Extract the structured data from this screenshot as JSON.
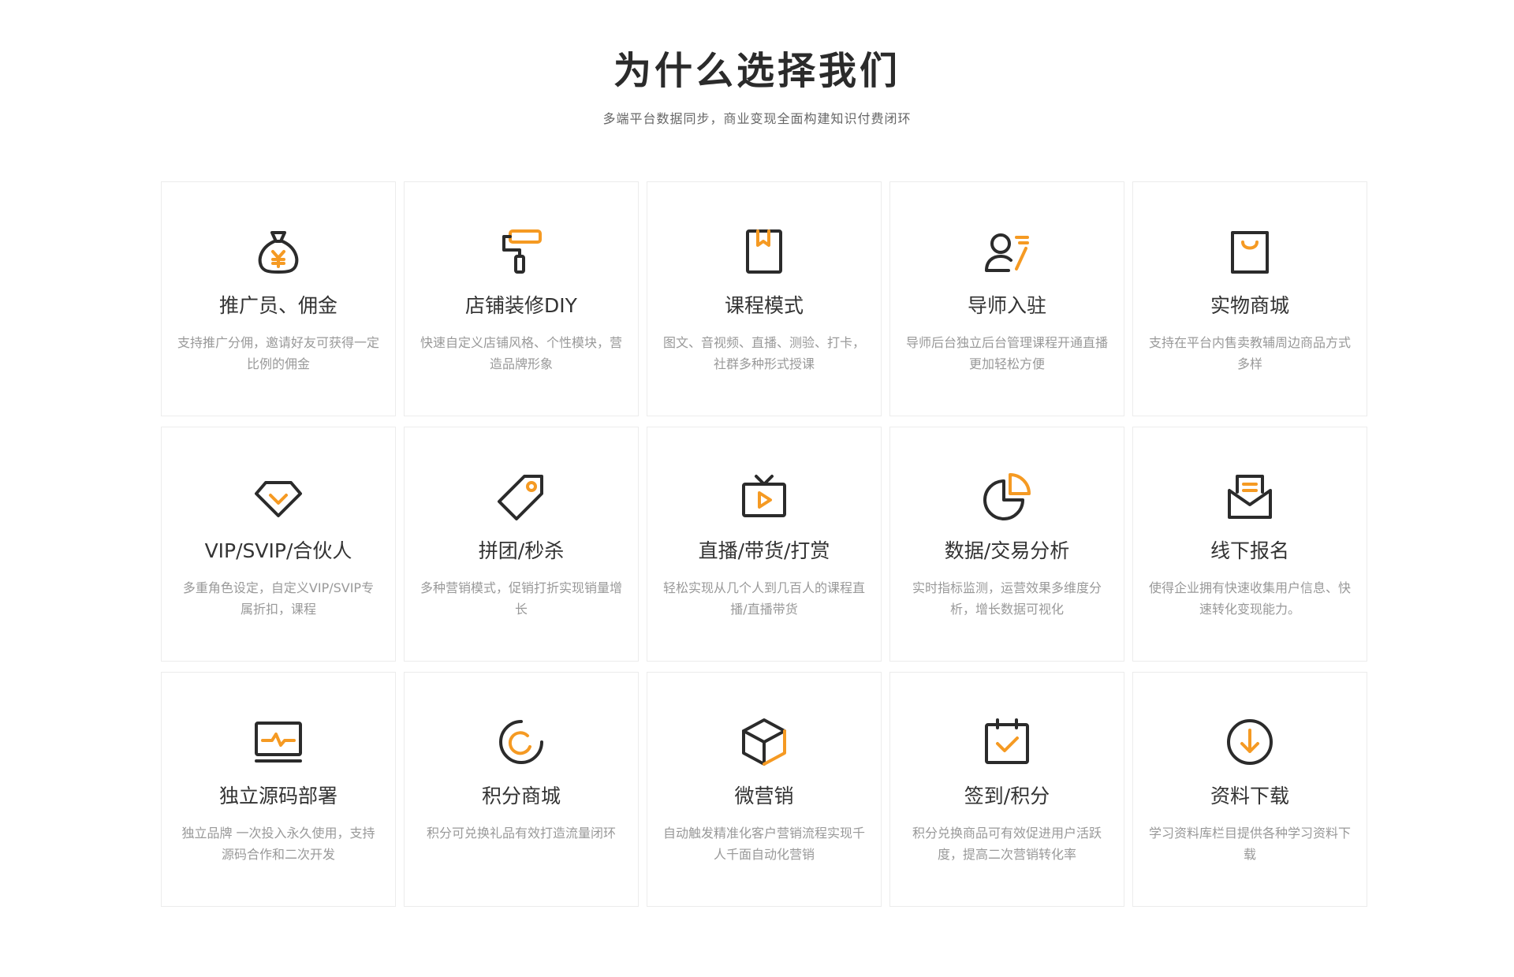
{
  "header": {
    "title": "为什么选择我们",
    "subtitle": "多端平台数据同步，商业变现全面构建知识付费闭环"
  },
  "colors": {
    "accent": "#f59a23",
    "stroke": "#2b2b2b"
  },
  "features": [
    {
      "icon": "money-bag-icon",
      "title": "推广员、佣金",
      "desc": "支持推广分佣，邀请好友可获得一定比例的佣金"
    },
    {
      "icon": "paint-roller-icon",
      "title": "店铺装修DIY",
      "desc": "快速自定义店铺风格、个性模块，营造品牌形象"
    },
    {
      "icon": "bookmark-book-icon",
      "title": "课程模式",
      "desc": "图文、音视频、直播、测验、打卡，社群多种形式授课"
    },
    {
      "icon": "mentor-user-icon",
      "title": "导师入驻",
      "desc": "导师后台独立后台管理课程开通直播更加轻松方便"
    },
    {
      "icon": "shopping-bag-icon",
      "title": "实物商城",
      "desc": "支持在平台内售卖教辅周边商品方式多样"
    },
    {
      "icon": "diamond-icon",
      "title": "VIP/SVIP/合伙人",
      "desc": "多重角色设定，自定义VIP/SVIP专属折扣，课程"
    },
    {
      "icon": "price-tag-icon",
      "title": "拼团/秒杀",
      "desc": "多种营销模式，促销打折实现销量增长"
    },
    {
      "icon": "live-tv-icon",
      "title": "直播/带货/打赏",
      "desc": "轻松实现从几个人到几百人的课程直播/直播带货"
    },
    {
      "icon": "pie-chart-icon",
      "title": "数据/交易分析",
      "desc": "实时指标监测，运营效果多维度分析，增长数据可视化"
    },
    {
      "icon": "mail-envelope-icon",
      "title": "线下报名",
      "desc": "使得企业拥有快速收集用户信息、快速转化变现能力。"
    },
    {
      "icon": "monitor-pulse-icon",
      "title": "独立源码部署",
      "desc": "独立品牌 一次投入永久使用，支持源码合作和二次开发"
    },
    {
      "icon": "points-circle-icon",
      "title": "积分商城",
      "desc": "积分可兑换礼品有效打造流量闭环"
    },
    {
      "icon": "cube-box-icon",
      "title": "微营销",
      "desc": "自动触发精准化客户营销流程实现千人千面自动化营销"
    },
    {
      "icon": "calendar-check-icon",
      "title": "签到/积分",
      "desc": "积分兑换商品可有效促进用户活跃度，提高二次营销转化率"
    },
    {
      "icon": "download-circle-icon",
      "title": "资料下载",
      "desc": "学习资料库栏目提供各种学习资料下载"
    }
  ]
}
